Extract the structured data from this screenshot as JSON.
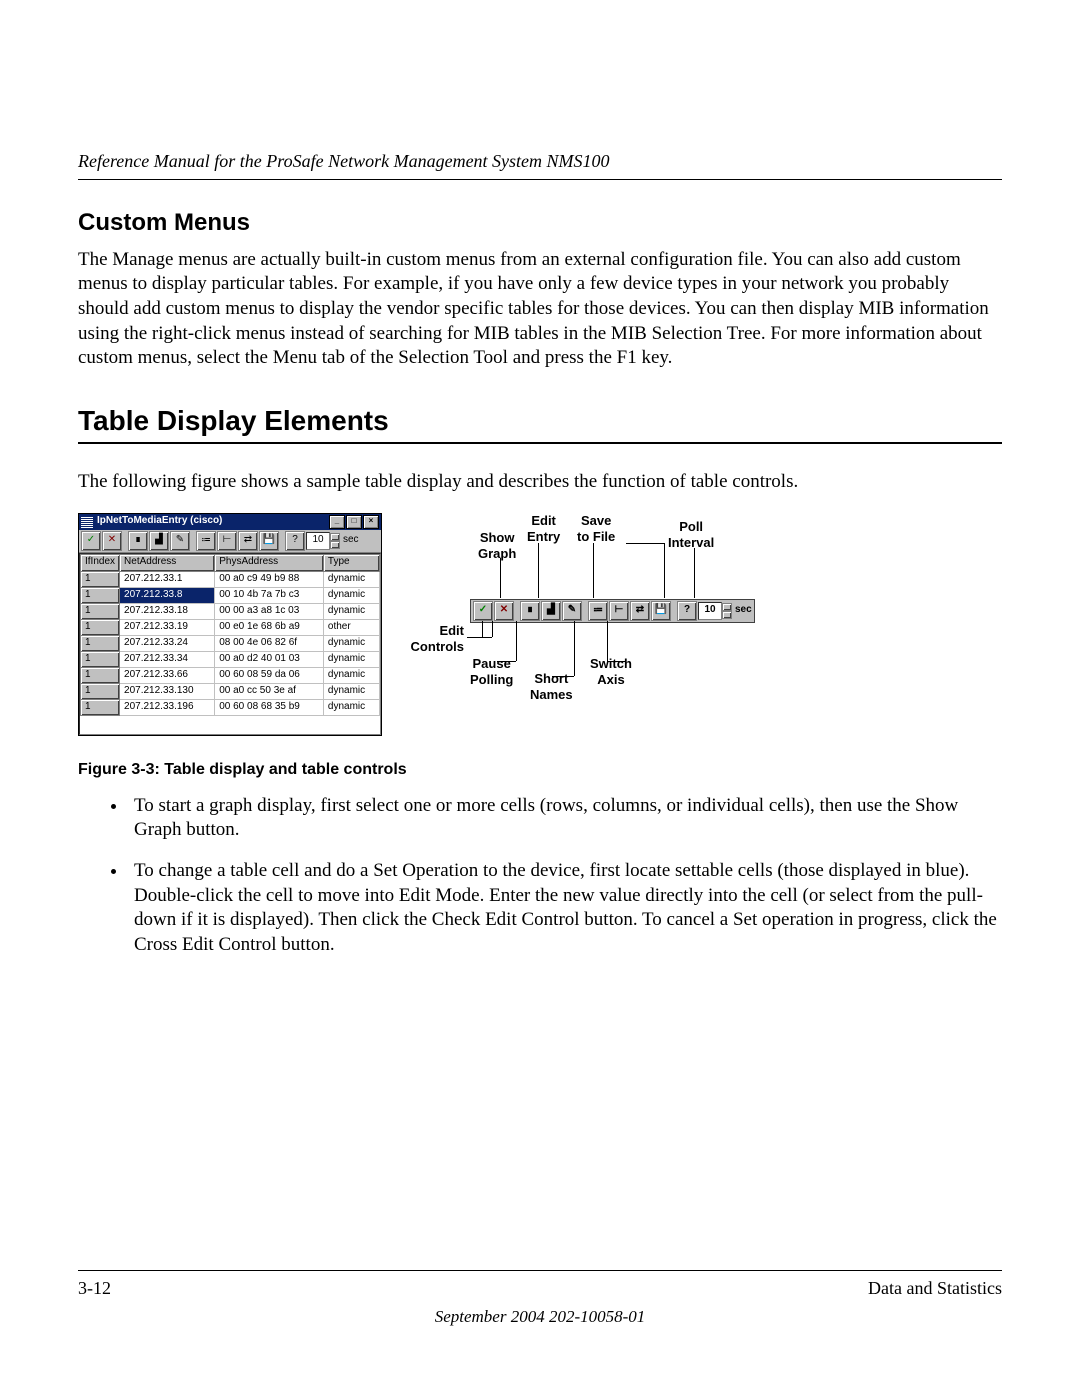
{
  "running_head": "Reference Manual for the ProSafe Network Management System NMS100",
  "section_custom_menus": "Custom Menus",
  "para_custom_menus": "The Manage menus are actually built-in custom menus from an external configuration file. You can also add custom menus to display particular tables. For example, if you have only a few device types in your network you probably should add custom menus to display the vendor specific tables for those devices. You can then display MIB information using the right-click menus instead of searching for MIB tables in the MIB Selection Tree. For more information about custom menus, select the Menu tab of the Selection Tool and press the F1 key.",
  "section_table_display": "Table Display Elements",
  "para_table_display": "The following figure shows a sample table display and describes the function of table controls.",
  "window": {
    "title": "IpNetToMediaEntry (cisco)",
    "poll_value": "10",
    "poll_unit": "sec",
    "columns": [
      "IfIndex",
      "NetAddress",
      "PhysAddress",
      "Type"
    ],
    "rows": [
      {
        "ifindex": "1",
        "net": "207.212.33.1",
        "phys": "00 a0 c9 49 b9 88",
        "type": "dynamic",
        "selected": false
      },
      {
        "ifindex": "1",
        "net": "207.212.33.8",
        "phys": "00 10 4b 7a 7b c3",
        "type": "dynamic",
        "selected": true
      },
      {
        "ifindex": "1",
        "net": "207.212.33.18",
        "phys": "00 00 a3 a8 1c 03",
        "type": "dynamic",
        "selected": false
      },
      {
        "ifindex": "1",
        "net": "207.212.33.19",
        "phys": "00 e0 1e 68 6b a9",
        "type": "other",
        "selected": false
      },
      {
        "ifindex": "1",
        "net": "207.212.33.24",
        "phys": "08 00 4e 06 82 6f",
        "type": "dynamic",
        "selected": false
      },
      {
        "ifindex": "1",
        "net": "207.212.33.34",
        "phys": "00 a0 d2 40 01 03",
        "type": "dynamic",
        "selected": false
      },
      {
        "ifindex": "1",
        "net": "207.212.33.66",
        "phys": "00 60 08 59 da 06",
        "type": "dynamic",
        "selected": false
      },
      {
        "ifindex": "1",
        "net": "207.212.33.130",
        "phys": "00 a0 cc 50 3e af",
        "type": "dynamic",
        "selected": false
      },
      {
        "ifindex": "1",
        "net": "207.212.33.196",
        "phys": "00 60 08 68 35 b9",
        "type": "dynamic",
        "selected": false
      }
    ]
  },
  "toolbar_glyphs": {
    "check": "✓",
    "cross": "✕",
    "pause": "∎",
    "graph": "▟",
    "edit": "✎",
    "short": "⩴",
    "axis": "⊢",
    "switch": "⇄",
    "save": "💾",
    "help": "?"
  },
  "callouts": {
    "edit_entry": "Edit Entry",
    "save_file": "Save to File",
    "poll_interval": "Poll Interval",
    "show_graph": "Show Graph",
    "edit_controls": "Edit Controls",
    "pause_polling": "Pause Polling",
    "short_names": "Short Names",
    "switch_axis": "Switch Axis",
    "poll_value": "10",
    "poll_unit": "sec"
  },
  "figure_caption": "Figure 3-3:  Table display and table controls",
  "bullets": [
    "To start a graph display, first select one or more cells (rows, columns, or individual cells), then use the Show Graph button.",
    "To change a table cell and do a Set Operation to the device, first locate settable cells (those displayed in blue). Double-click the cell to move into Edit Mode. Enter the new value directly into the cell (or select from the pull-down if it is displayed). Then click the Check Edit Control button. To cancel a Set operation in progress, click the Cross Edit Control button."
  ],
  "footer": {
    "page_num": "3-12",
    "chapter": "Data and Statistics",
    "docid": "September 2004 202-10058-01"
  }
}
